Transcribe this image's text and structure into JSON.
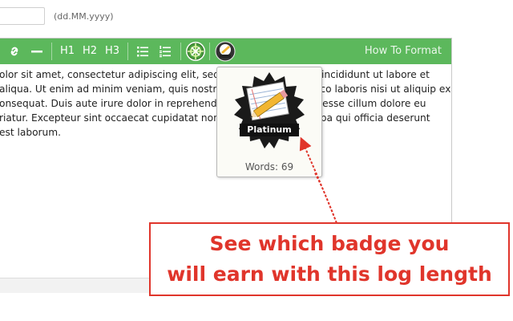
{
  "date_field": {
    "value": "",
    "hint": "(dd.MM.yyyy)"
  },
  "toolbar": {
    "link_icon": "link-icon",
    "hr_icon": "horizontal-rule-icon",
    "h1": "H1",
    "h2": "H2",
    "h3": "H3",
    "bullet_icon": "bulleted-list-icon",
    "number_icon": "numbered-list-icon",
    "gps_icon": "gps-crosshair-icon",
    "badge_icon": "badge-icon",
    "how_to_format": "How To Format",
    "color": "#5cb85c"
  },
  "editor": {
    "lines": [
      "olor sit amet, consectetur adipiscing elit, sed do eiusmod tempor incididunt ut labore et",
      "aliqua. Ut enim ad minim veniam, quis nostrud exercitation ullamco laboris nisi ut aliquip ex",
      "onsequat. Duis aute irure dolor in reprehenderit in voluptate velit esse cillum dolore eu",
      "riatur. Excepteur sint occaecat cupidatat non proident, sunt in culpa qui officia deserunt",
      "est laborum."
    ]
  },
  "badge_popup": {
    "badge_label": "Platinum",
    "words": "Words: 69"
  },
  "callout": {
    "line1": "See which badge you",
    "line2": "will earn with this log length",
    "color": "#e0352b"
  }
}
